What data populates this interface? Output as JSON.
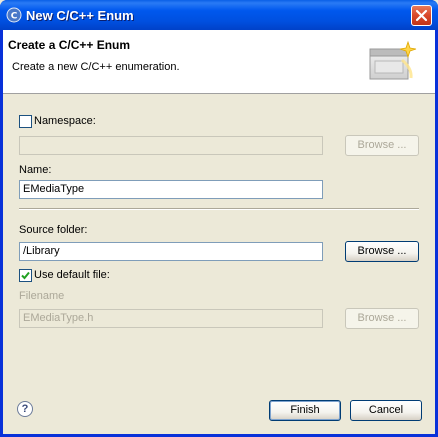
{
  "window": {
    "title": "New C/C++ Enum",
    "app_icon": "eclipse-cdt-icon",
    "close_icon": "close-icon"
  },
  "banner": {
    "title": "Create a C/C++ Enum",
    "description": "Create a new C/C++ enumeration.",
    "graphic": "new-enum-wizard-graphic"
  },
  "form": {
    "namespace": {
      "label": "Namespace:",
      "checked": false,
      "value": "",
      "browse_label": "Browse ..."
    },
    "name": {
      "label": "Name:",
      "value": "EMediaType"
    },
    "source_folder": {
      "label": "Source folder:",
      "value": "/Library",
      "browse_label": "Browse ..."
    },
    "use_default_file": {
      "label": "Use default file:",
      "checked": true
    },
    "filename": {
      "label": "Filename",
      "value": "EMediaType.h",
      "browse_label": "Browse ..."
    }
  },
  "footer": {
    "help_icon": "help-icon",
    "help_glyph": "?",
    "finish_label": "Finish",
    "cancel_label": "Cancel"
  },
  "colors": {
    "titlebar": "#0058ee",
    "dialog_bg": "#ece9d8",
    "field_border": "#7f9db9",
    "disabled_text": "#aca899"
  }
}
